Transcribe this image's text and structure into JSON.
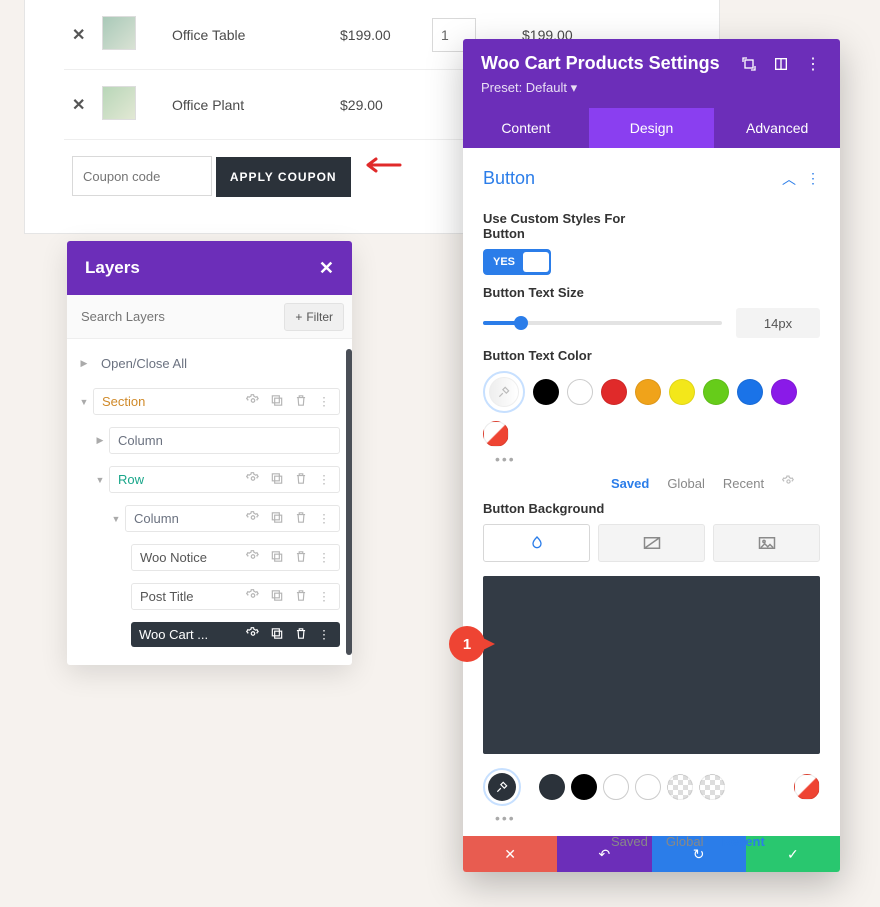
{
  "cart": {
    "rows": [
      {
        "name": "Office Table",
        "price": "$199.00",
        "qty": "1",
        "subtotal": "$199.00"
      },
      {
        "name": "Office Plant",
        "price": "$29.00",
        "qty": "",
        "subtotal": ""
      }
    ],
    "coupon_placeholder": "Coupon code",
    "apply_label": "APPLY COUPON"
  },
  "layers": {
    "title": "Layers",
    "search_placeholder": "Search Layers",
    "filter_label": "Filter",
    "open_close": "Open/Close All",
    "items": {
      "section": "Section",
      "column1": "Column",
      "row": "Row",
      "column2": "Column",
      "woo_notice": "Woo Notice",
      "post_title": "Post Title",
      "woo_cart": "Woo Cart ..."
    }
  },
  "settings": {
    "title": "Woo Cart Products Settings",
    "preset": "Preset: Default ▾",
    "tabs": {
      "content": "Content",
      "design": "Design",
      "advanced": "Advanced"
    },
    "section_button": "Button",
    "use_custom_line1": "Use Custom Styles For",
    "use_custom_line2": "Button",
    "yes": "YES",
    "text_size_label": "Button Text Size",
    "text_size_value": "14px",
    "text_color_label": "Button Text Color",
    "color_tabs": {
      "saved": "Saved",
      "global": "Global",
      "recent": "Recent"
    },
    "bg_label": "Button Background",
    "swatch_colors": [
      "#000000",
      "#ffffff",
      "#e02a2a",
      "#f0a31a",
      "#f3e71a",
      "#66cc1a",
      "#1a73e8",
      "#8a1ae8"
    ],
    "picker_recent": [
      "#2b323a",
      "#000000",
      "#ffffff",
      "#ffffff",
      "checker",
      "checker"
    ],
    "annot1": "1"
  }
}
